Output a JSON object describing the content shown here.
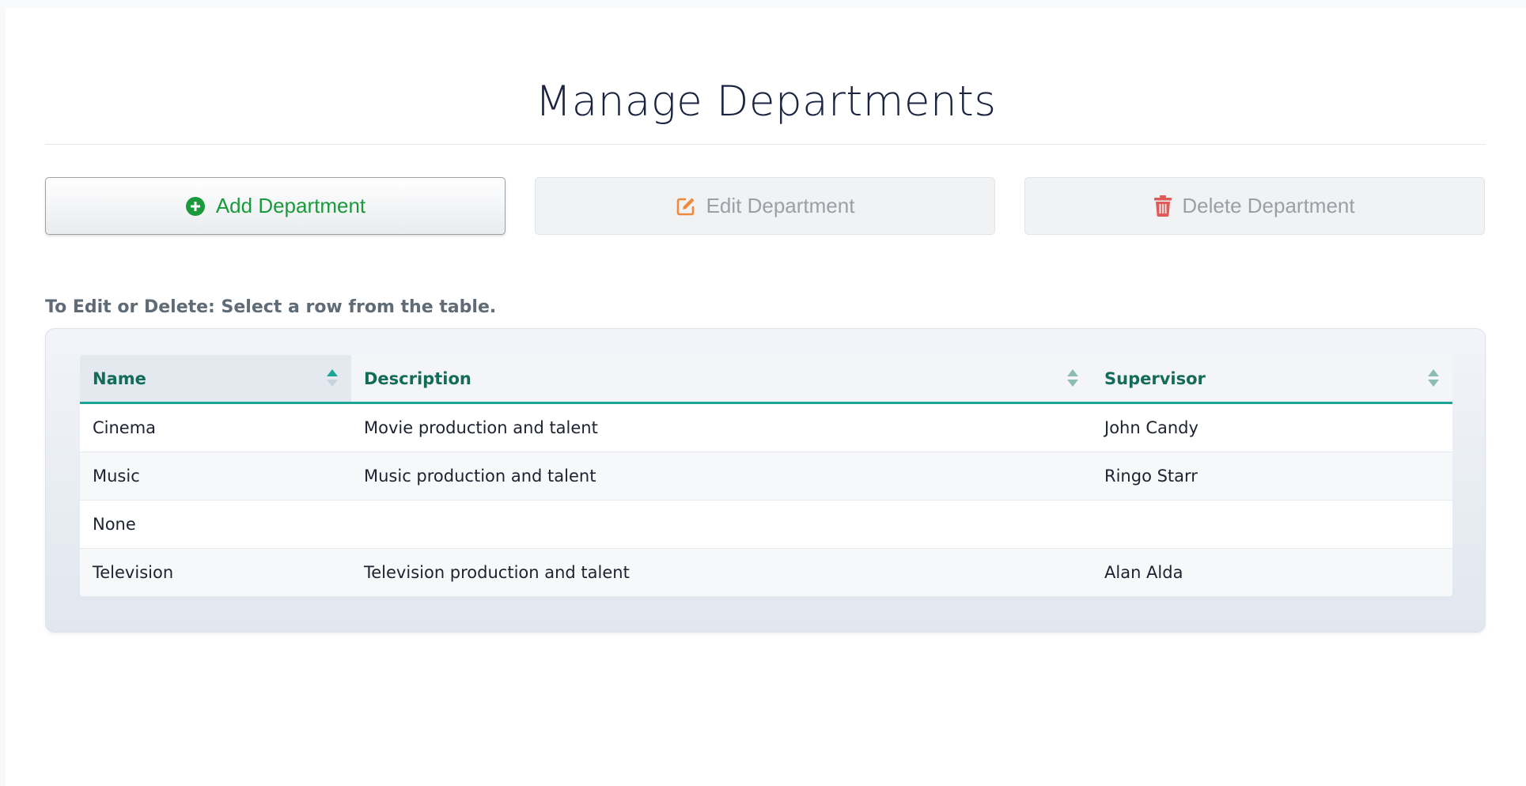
{
  "page": {
    "title": "Manage Departments",
    "hint": "To Edit or Delete: Select a row from the table."
  },
  "toolbar": {
    "add_label": "Add Department",
    "edit_label": "Edit Department",
    "delete_label": "Delete Department",
    "add_icon": "plus-circle-icon",
    "edit_icon": "edit-icon",
    "delete_icon": "trash-icon"
  },
  "colors": {
    "add": "#1a9a3c",
    "edit_icon": "#f0883e",
    "delete_icon": "#e05a5a",
    "header_text": "#136b5a",
    "header_border": "#1aa594"
  },
  "table": {
    "columns": [
      "Name",
      "Description",
      "Supervisor"
    ],
    "sorted_column": "Name",
    "sort_direction": "ascending",
    "rows": [
      [
        "Cinema",
        "Movie production and talent",
        "John Candy"
      ],
      [
        "Music",
        "Music production and talent",
        "Ringo Starr"
      ],
      [
        "None",
        "",
        ""
      ],
      [
        "Television",
        "Television production and talent",
        "Alan Alda"
      ]
    ]
  }
}
